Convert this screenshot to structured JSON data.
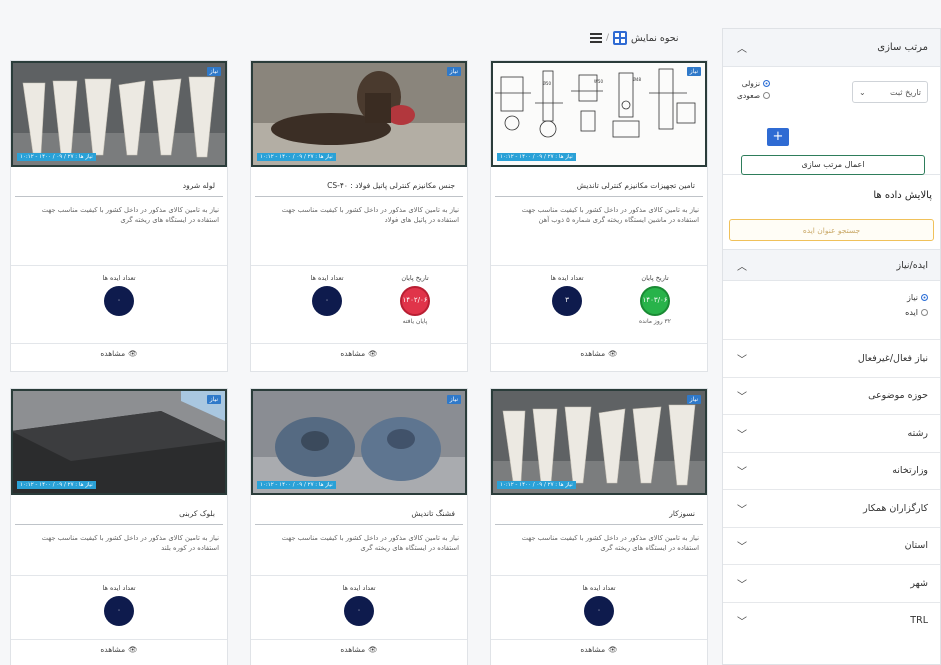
{
  "view_bar": {
    "label": "نحوه نمایش"
  },
  "sidebar": {
    "sort": {
      "title": "مرتب سازی",
      "select_value": "تاریخ ثبت",
      "options": [
        "نزولی",
        "صعودی"
      ],
      "apply_label": "اعمال مرتب سازی",
      "add_label": "+"
    },
    "filter_title": "پالایش داده ها",
    "search_placeholder": "جستجو عنوان ایده",
    "open_section": {
      "title": "ایده/نیاز",
      "options": [
        "نیاز",
        "ایده"
      ]
    },
    "sections": [
      "نیاز فعال/غیرفعال",
      "حوزه موضوعی",
      "رشته",
      "وزارتخانه",
      "کارگزاران همکار",
      "استان",
      "شهر",
      "TRL"
    ]
  },
  "cards": [
    {
      "badge": "نیاز",
      "caption": "نیاز ها : ۲۷ / ۰۹ / ۱۴۰۰ - ۱۰:۱۲",
      "title": "تامین تجهیزات مکانیزم کنترلی تاندیش",
      "desc": "نیاز به تامین کالای مذکور در داخل کشور با کیفیت مناسب جهت استفاده در ماشین ایستگاه ریخته گری شماره ۵ ذوب آهن",
      "stat_date_label": "تاریخ پایان",
      "stat_date_value": "۱۴۰۳/۰۶",
      "stat_date_sub": "۳۲ روز مانده",
      "stat_count_label": "تعداد ایده ها",
      "stat_count_value": "۳",
      "view": "مشاهده"
    },
    {
      "badge": "نیاز",
      "caption": "نیاز ها : ۲۷ / ۰۹ / ۱۴۰۰ - ۱۰:۱۲",
      "title": "جنس مکانیزم کنترلی پاتیل فولاد : CS-۴۰",
      "desc": "نیاز به تامین کالای مذکور در داخل کشور با کیفیت مناسب جهت استفاده در پاتیل های فولاد",
      "stat_date_label": "تاریخ پایان",
      "stat_date_value": "۱۴۰۲/۰۶",
      "stat_date_sub": "پایان یافته",
      "stat_count_label": "تعداد ایده ها",
      "stat_count_value": "۰",
      "view": "مشاهده"
    },
    {
      "badge": "نیاز",
      "caption": "نیاز ها : ۲۷ / ۰۹ / ۱۴۰۰ - ۱۰:۱۲",
      "title": "لوله شرود",
      "desc": "نیاز به تامین کالای مذکور در داخل کشور با کیفیت مناسب جهت استفاده در ایستگاه های ریخته گری",
      "stat_count_label": "تعداد ایده ها",
      "stat_count_value": "۰",
      "view": "مشاهده"
    },
    {
      "badge": "نیاز",
      "caption": "نیاز ها : ۲۷ / ۰۹ / ۱۴۰۰ - ۱۰:۱۲",
      "title": "نسوزکار",
      "desc": "نیاز به تامین کالای مذکور در داخل کشور با کیفیت مناسب جهت استفاده در ایستگاه های ریخته گری",
      "stat_count_label": "تعداد ایده ها",
      "stat_count_value": "۰",
      "view": "مشاهده"
    },
    {
      "badge": "نیاز",
      "caption": "نیاز ها : ۲۷ / ۰۹ / ۱۴۰۰ - ۱۰:۱۲",
      "title": "فشنگ تاندیش",
      "desc": "نیاز به تامین کالای مذکور در داخل کشور با کیفیت مناسب جهت استفاده در ایستگاه های ریخته گری",
      "stat_count_label": "تعداد ایده ها",
      "stat_count_value": "۰",
      "view": "مشاهده"
    },
    {
      "badge": "نیاز",
      "caption": "نیاز ها : ۲۷ / ۰۹ / ۱۴۰۰ - ۱۰:۱۲",
      "title": "بلوک کربنی",
      "desc": "نیاز به تامین کالای مذکور در داخل کشور با کیفیت مناسب جهت استفاده در کوره بلند",
      "stat_count_label": "تعداد ایده ها",
      "stat_count_value": "۰",
      "view": "مشاهده"
    }
  ]
}
